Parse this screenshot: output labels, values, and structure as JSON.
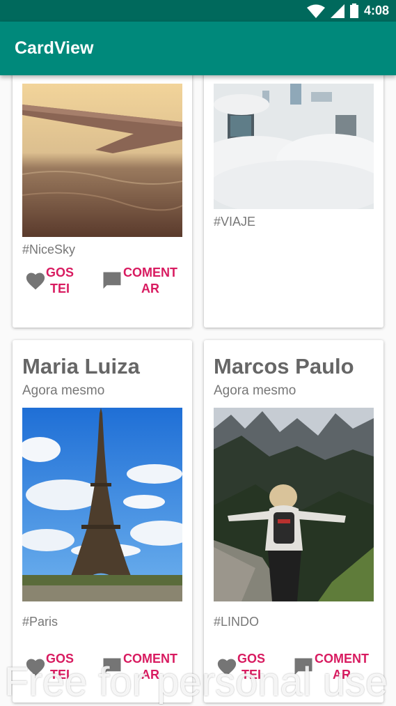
{
  "status_bar": {
    "time": "4:08"
  },
  "app_bar": {
    "title": "CardView"
  },
  "cards": [
    {
      "tag": "#NiceSky",
      "like_label": "GOS TEI",
      "comment_label": "COMENT AR"
    },
    {
      "tag": "#VIAJE"
    },
    {
      "author": "Maria Luiza",
      "time": "Agora mesmo",
      "tag": "#Paris",
      "like_label": "GOS TEI",
      "comment_label": "COMENT AR"
    },
    {
      "author": "Marcos Paulo",
      "time": "Agora mesmo",
      "tag": "#LINDO",
      "like_label": "GOS TEI",
      "comment_label": "COMENT AR"
    }
  ],
  "watermark": "Free for personal use",
  "colors": {
    "status_bar": "#00695c",
    "app_bar": "#00897b",
    "accent": "#d81b60"
  }
}
